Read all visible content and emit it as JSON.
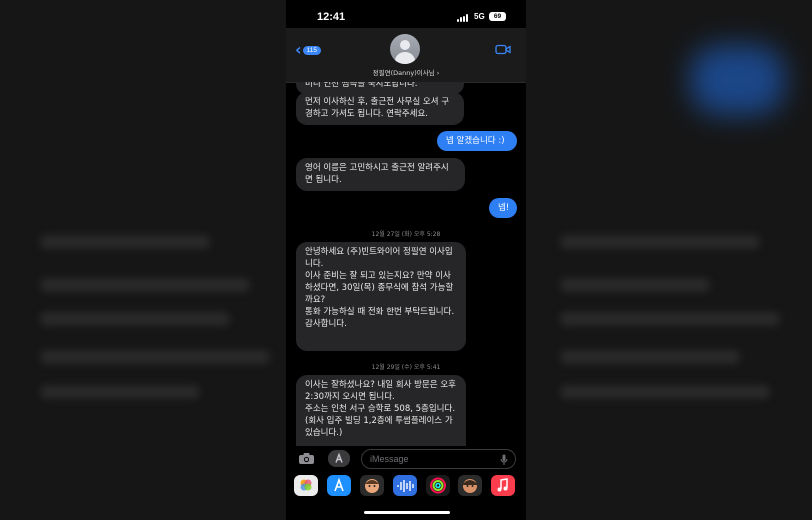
{
  "status": {
    "time": "12:41",
    "network": "5G",
    "battery": "69"
  },
  "header": {
    "back_count": "115",
    "contact_name": "정필연(Danny)이사님 ›"
  },
  "messages": [
    {
      "dir": "in",
      "text": "미니 인천 찜즉을 숙지노답니다."
    },
    {
      "dir": "in",
      "text": "먼저 이사하신 후, 출근전 사무실 오셔 구경하고 가셔도 됩니다. 연락주세요."
    },
    {
      "dir": "out",
      "text": "넵 알겠습니다 :)"
    },
    {
      "dir": "in",
      "text": "영어 이름은 고민하시고 출근전 알려주시면 됩니다."
    },
    {
      "dir": "out",
      "text": "넵!"
    },
    {
      "dir": "ts",
      "text": "12월 27일 (화) 오후 5:28"
    },
    {
      "dir": "in",
      "text": "안녕하세요 (주)빈트와이어 정필연 이사입니다.\n이사 준비는 잘 되고 있는지요? 만약 이사 하셨다면, 30일(목) 종무식에 참석 가능할까요?\n통화 가능하실 때 전화 한번 부탁드립니다.\n감사합니다."
    },
    {
      "dir": "ts",
      "text": "12월 29일 (수) 오후 5:41"
    },
    {
      "dir": "in",
      "text": "이사는 잘하셨나요? 내일 회사 방문은 오후 2:30까지 오시면 됩니다.\n주소는 인천 서구 승학로 508, 5층입니다.\n(회사 입주 빌딩 1,2층에 투썸플레이스 가 있습니다.)"
    }
  ],
  "composer": {
    "placeholder": "iMessage"
  },
  "icons": [
    "camera-icon",
    "app-store-icon",
    "mic-icon",
    "photos-icon",
    "memoji-icon",
    "audio-icon",
    "fitness-icon",
    "music-icon"
  ],
  "colors": {
    "outgoing": "#2f7ff4",
    "incoming": "#262628",
    "accent": "#3b86f7"
  }
}
